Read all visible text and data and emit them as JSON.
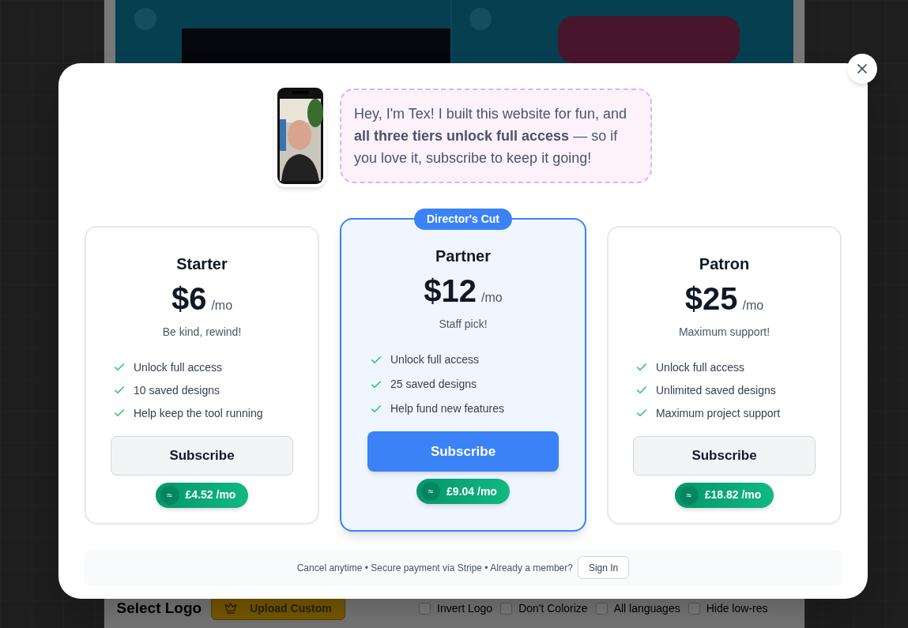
{
  "background": {
    "logo_section": {
      "title": "Select Logo",
      "upload_button": "Upload Custom",
      "options": [
        {
          "label": "Invert Logo",
          "checked": false
        },
        {
          "label": "Don't Colorize",
          "checked": false
        },
        {
          "label": "All languages",
          "checked": false
        },
        {
          "label": "Hide low-res",
          "checked": false
        }
      ]
    }
  },
  "dialog": {
    "intro": {
      "text": "Hey, I'm Tex! I built this website for fun, and **all three tiers unlock full access** — so if you love it, subscribe to keep it going!"
    },
    "plans": [
      {
        "name": "Starter",
        "price": "$6",
        "period": "/mo",
        "tagline": "Be kind, rewind!",
        "features": [
          "Unlock full access",
          "10 saved designs",
          "Help keep the tool running"
        ],
        "button": "Subscribe",
        "approx_symbol": "≈",
        "converted_price": "£4.52 /mo",
        "featured": false
      },
      {
        "name": "Partner",
        "price": "$12",
        "period": "/mo",
        "tagline": "Staff pick!",
        "badge": "Director's Cut",
        "features": [
          "Unlock full access",
          "25 saved designs",
          "Help fund new features"
        ],
        "button": "Subscribe",
        "approx_symbol": "≈",
        "converted_price": "£9.04 /mo",
        "featured": true
      },
      {
        "name": "Patron",
        "price": "$25",
        "period": "/mo",
        "tagline": "Maximum support!",
        "features": [
          "Unlock full access",
          "Unlimited saved designs",
          "Maximum project support"
        ],
        "button": "Subscribe",
        "approx_symbol": "≈",
        "converted_price": "£18.82 /mo",
        "featured": false
      }
    ],
    "footer": {
      "text": "Cancel anytime • Secure payment via Stripe • Already a member?",
      "button": "Sign In"
    }
  }
}
